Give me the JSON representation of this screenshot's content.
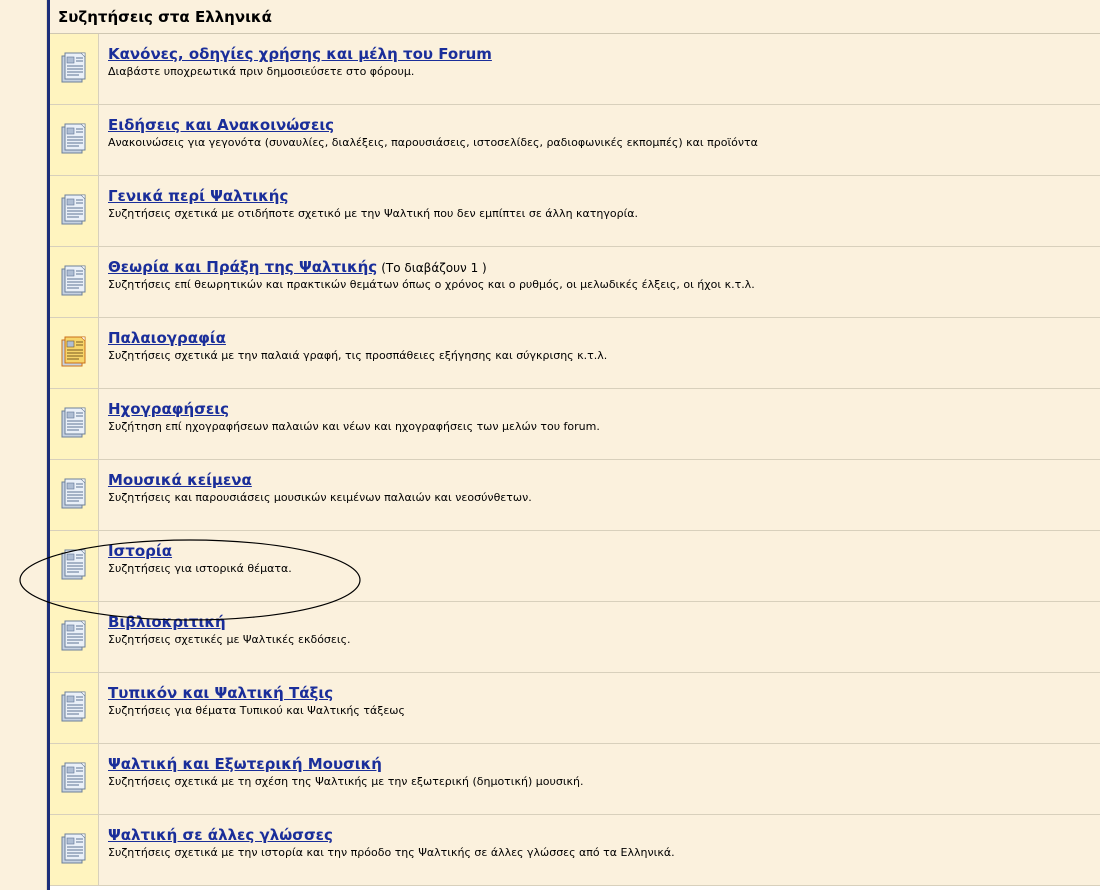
{
  "section": {
    "title": "Συζητήσεις στα Ελληνικά"
  },
  "forums": [
    {
      "title": "Κανόνες, οδηγίες χρήσης και μέλη του Forum",
      "extra": "",
      "description": "Διαβάστε υποχρεωτικά πριν δημοσιεύσετε στο φόρουμ.",
      "icon": "forum-no-new-posts-icon"
    },
    {
      "title": "Ειδήσεις και Ανακοινώσεις",
      "extra": "",
      "description": "Ανακοινώσεις για γεγονότα (συναυλίες, διαλέξεις, παρουσιάσεις, ιστοσελίδες, ραδιοφωνικές εκπομπές) και προϊόντα",
      "icon": "forum-no-new-posts-icon"
    },
    {
      "title": "Γενικά περί Ψαλτικής",
      "extra": "",
      "description": "Συζητήσεις σχετικά με οτιδήποτε σχετικό με την Ψαλτική που δεν εμπίπτει σε άλλη κατηγορία.",
      "icon": "forum-no-new-posts-icon"
    },
    {
      "title": "Θεωρία και Πράξη της Ψαλτικής",
      "extra": "(Το διαβάζουν 1 )",
      "description": "Συζητήσεις επί θεωρητικών και πρακτικών θεμάτων όπως ο χρόνος και ο ρυθμός, οι μελωδικές έλξεις, οι ήχοι κ.τ.λ.",
      "icon": "forum-no-new-posts-icon"
    },
    {
      "title": "Παλαιογραφία",
      "extra": "",
      "description": "Συζητήσεις σχετικά με την παλαιά γραφή, τις προσπάθειες εξήγησης και σύγκρισης κ.τ.λ.",
      "icon": "forum-new-posts-icon"
    },
    {
      "title": "Ηχογραφήσεις",
      "extra": "",
      "description": "Συζήτηση επί ηχογραφήσεων παλαιών και νέων και ηχογραφήσεις των μελών του forum.",
      "icon": "forum-no-new-posts-icon"
    },
    {
      "title": "Μουσικά κείμενα",
      "extra": "",
      "description": "Συζητήσεις και παρουσιάσεις μουσικών κειμένων παλαιών και νεοσύνθετων.",
      "icon": "forum-no-new-posts-icon"
    },
    {
      "title": "Ιστορία",
      "extra": "",
      "description": "Συζητήσεις για ιστορικά θέματα.",
      "icon": "forum-no-new-posts-icon"
    },
    {
      "title": "Βιβλιοκριτική",
      "extra": "",
      "description": "Συζητήσεις σχετικές με Ψαλτικές εκδόσεις.",
      "icon": "forum-no-new-posts-icon"
    },
    {
      "title": "Τυπικόν και Ψαλτική Τάξις",
      "extra": "",
      "description": "Συζητήσεις για θέματα Τυπικού και Ψαλτικής τάξεως",
      "icon": "forum-no-new-posts-icon"
    },
    {
      "title": "Ψαλτική και Εξωτερική Μουσική",
      "extra": "",
      "description": "Συζητήσεις σχετικά με τη σχέση της Ψαλτικής με την εξωτερική (δημοτική) μουσική.",
      "icon": "forum-no-new-posts-icon"
    },
    {
      "title": "Ψαλτική σε άλλες γλώσσες",
      "extra": "",
      "description": "Συζητήσεις σχετικά με την ιστορία και την πρόοδο της Ψαλτικής σε άλλες γλώσσες από τα Ελληνικά.",
      "icon": "forum-no-new-posts-icon"
    }
  ],
  "colors": {
    "row_background": "#fbf1dd",
    "icon_cell_background": "#fff4bf",
    "link": "#1a2e9a",
    "board_border": "#1c2e7a",
    "annotation": "#000000"
  }
}
